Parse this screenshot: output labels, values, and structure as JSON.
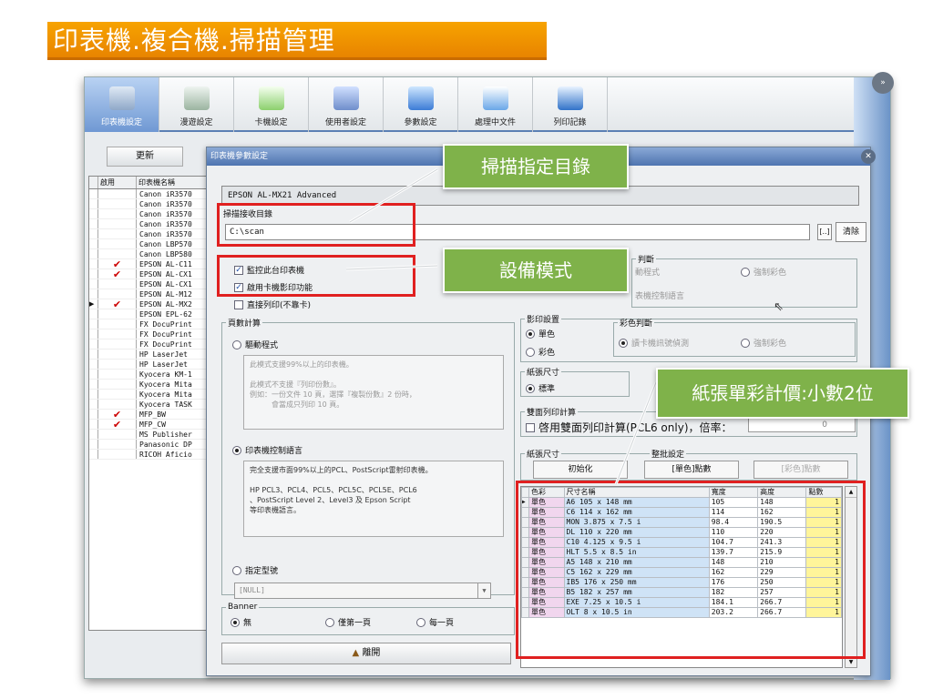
{
  "banner": {
    "title": "印表機.複合機.掃描管理"
  },
  "toolbar": {
    "items": [
      {
        "label": "印表機設定",
        "icon": "printer-icon"
      },
      {
        "label": "漫遊設定",
        "icon": "roaming-icon"
      },
      {
        "label": "卡機設定",
        "icon": "card-reader-icon"
      },
      {
        "label": "使用者設定",
        "icon": "user-icon"
      },
      {
        "label": "參數設定",
        "icon": "parameter-icon"
      },
      {
        "label": "處理中文件",
        "icon": "processing-doc-icon"
      },
      {
        "label": "列印記錄",
        "icon": "print-log-icon"
      }
    ]
  },
  "main": {
    "refresh_label": "更新"
  },
  "printer_list": {
    "col_enabled": "啟用",
    "col_name": "印表機名稱",
    "rows": [
      {
        "enabled": "",
        "name": "Canon iR3570"
      },
      {
        "enabled": "",
        "name": "Canon iR3570"
      },
      {
        "enabled": "",
        "name": "Canon iR3570"
      },
      {
        "enabled": "",
        "name": "Canon iR3570"
      },
      {
        "enabled": "",
        "name": "Canon iR3570"
      },
      {
        "enabled": "",
        "name": "Canon LBP570"
      },
      {
        "enabled": "",
        "name": "Canon LBP580"
      },
      {
        "enabled": "✔",
        "name": "EPSON AL-C11"
      },
      {
        "enabled": "✔",
        "name": "EPSON AL-CX1"
      },
      {
        "enabled": "",
        "name": "EPSON AL-CX1"
      },
      {
        "enabled": "",
        "name": "EPSON AL-M12"
      },
      {
        "enabled": "✔",
        "name": "EPSON AL-MX2"
      },
      {
        "enabled": "",
        "name": "EPSON EPL-62"
      },
      {
        "enabled": "",
        "name": "FX DocuPrint"
      },
      {
        "enabled": "",
        "name": "FX DocuPrint"
      },
      {
        "enabled": "",
        "name": "FX DocuPrint"
      },
      {
        "enabled": "",
        "name": "HP LaserJet"
      },
      {
        "enabled": "",
        "name": "HP LaserJet"
      },
      {
        "enabled": "",
        "name": "Kyocera KM-1"
      },
      {
        "enabled": "",
        "name": "Kyocera Mita"
      },
      {
        "enabled": "",
        "name": "Kyocera Mita"
      },
      {
        "enabled": "",
        "name": "Kyocera TASK"
      },
      {
        "enabled": "✔",
        "name": "MFP_BW"
      },
      {
        "enabled": "✔",
        "name": "MFP_CW"
      },
      {
        "enabled": "",
        "name": "MS Publisher"
      },
      {
        "enabled": "",
        "name": "Panasonic DP"
      },
      {
        "enabled": "",
        "name": "RICOH Aficio"
      }
    ]
  },
  "dialog": {
    "title": "印表機參數設定",
    "model": "EPSON AL-MX21 Advanced",
    "scan_dir_label": "掃描接收目錄",
    "scan_dir_value": "C:\\scan",
    "browse_label": "[..]",
    "clear_label": "清除",
    "monitor_label": "監控此台印表機",
    "card_print_label": "啟用卡機影印功能",
    "direct_print_label": "直接列印(不靠卡)",
    "page_calc_legend": "頁數計算",
    "driver_mode_label": "驅動程式",
    "driver_desc": "此模式支援99%以上的印表機。\n\n此模式不支援『列印份數』。\n例如：一份文件 10 頁，選擇『複製份數』2 份時，\n　　　會當成只列印 10 頁。",
    "lang_mode_label": "印表機控制語言",
    "lang_desc": "完全支援市面99%以上的PCL、PostScript雷射印表機。\n\nHP PCL3、PCL4、PCL5、PCL5C、PCL5E、PCL6\n、PostScript Level 2、Level3 及 Epson Script\n等印表機語言。",
    "model_spec_label": "指定型號",
    "model_spec_value": "[NULL]",
    "banner_legend": "Banner",
    "banner_none": "無",
    "banner_first": "僅第一頁",
    "banner_each": "每一頁",
    "leave_label": "離開",
    "judge_legend": "判斷",
    "judge_driver": "動程式",
    "judge_force_color": "強制彩色",
    "judge_lang": "表機控制語言",
    "print_setting_legend": "影印設置",
    "mono_label": "單色",
    "color_label": "彩色",
    "color_judge_legend": "彩色判斷",
    "read_card_label": "讀卡機訊號偵測",
    "force_color_label": "強制彩色",
    "paper_size_legend": "紙張尺寸",
    "standard_label": "標準",
    "duplex_legend": "雙面列印計算",
    "duplex_label": "啓用雙面列印計算(PCL6 only)，倍率：",
    "duplex_value": "0",
    "paper_size2_legend": "紙張尺寸",
    "batch_legend": "整批設定",
    "init_button": "初始化",
    "mono_points_button": "[單色]點數",
    "color_points_button": "[彩色]點數"
  },
  "paper_table": {
    "headers": [
      "色彩",
      "尺寸名稱",
      "寬度",
      "高度",
      "點數"
    ],
    "rows": [
      [
        "單色",
        "A6 105 x 148 mm",
        "105",
        "148",
        "1"
      ],
      [
        "單色",
        "C6 114 x 162 mm",
        "114",
        "162",
        "1"
      ],
      [
        "單色",
        "MON 3.875 x 7.5 i",
        "98.4",
        "190.5",
        "1"
      ],
      [
        "單色",
        "DL 110 x 220 mm",
        "110",
        "220",
        "1"
      ],
      [
        "單色",
        "C10 4.125 x 9.5 i",
        "104.7",
        "241.3",
        "1"
      ],
      [
        "單色",
        "HLT 5.5 x 8.5 in",
        "139.7",
        "215.9",
        "1"
      ],
      [
        "單色",
        "A5 148 x 210 mm",
        "148",
        "210",
        "1"
      ],
      [
        "單色",
        "C5 162 x 229 mm",
        "162",
        "229",
        "1"
      ],
      [
        "單色",
        "IB5 176 x 250 mm",
        "176",
        "250",
        "1"
      ],
      [
        "單色",
        "B5 182 x 257 mm",
        "182",
        "257",
        "1"
      ],
      [
        "單色",
        "EXE 7.25 x 10.5 i",
        "184.1",
        "266.7",
        "1"
      ],
      [
        "單色",
        "OLT 8 x 10.5 in",
        "203.2",
        "266.7",
        "1"
      ]
    ]
  },
  "callouts": {
    "scan_dir": "掃描指定目錄",
    "device_mode": "設備模式",
    "paper_price": "紙張單彩計價:小數2位"
  },
  "colors": {
    "banner": "#f39c00",
    "callout": "#7fb24a",
    "highlight": "#e02020",
    "title_bar": "#4e74b0"
  }
}
